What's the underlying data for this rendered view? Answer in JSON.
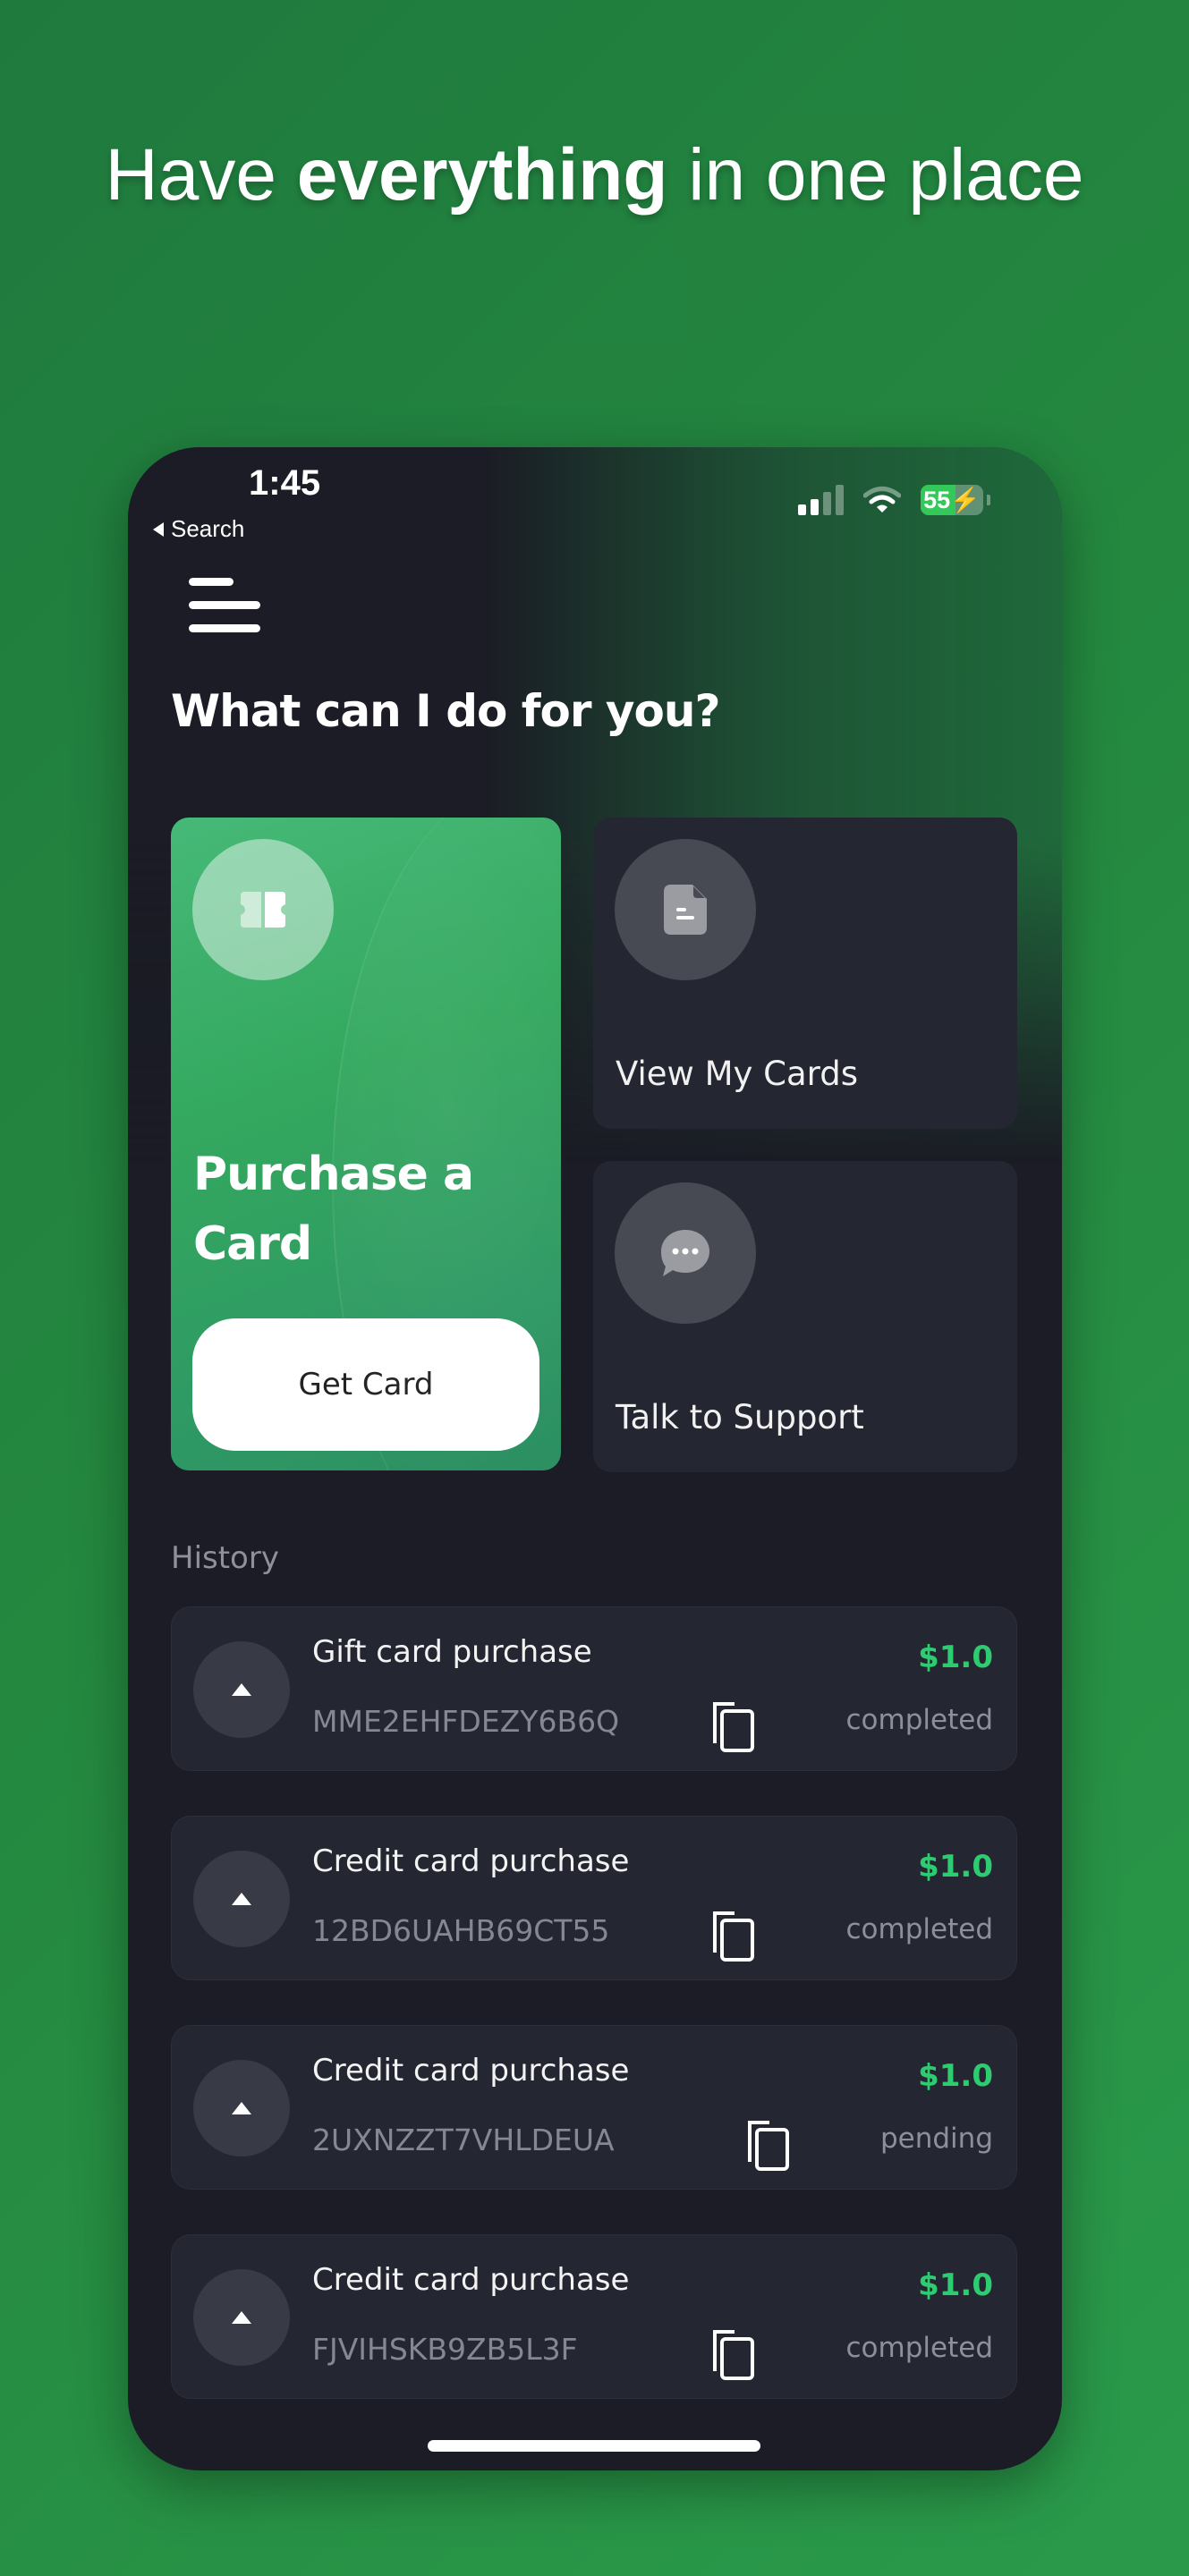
{
  "headline": {
    "prefix": "Have ",
    "bold": "everything",
    "suffix": " in one place"
  },
  "status_bar": {
    "time": "1:45",
    "back_label": "Search",
    "battery_percent": 55,
    "battery_text": "55",
    "battery_charging": true,
    "signal_bars_active": 2,
    "signal_bars_total": 4,
    "icons": [
      "signal-icon",
      "wifi-icon",
      "battery-charging-icon"
    ]
  },
  "header": {
    "menu_icon": "hamburger-menu-icon",
    "title": "What can I do for you?"
  },
  "actions": {
    "purchase": {
      "icon": "ticket-card-icon",
      "title": "Purchase a Card",
      "button_label": "Get Card"
    },
    "view_cards": {
      "icon": "document-icon",
      "label": "View My Cards"
    },
    "support": {
      "icon": "chat-bubble-icon",
      "label": "Talk to Support"
    }
  },
  "history": {
    "label": "History",
    "items": [
      {
        "title": "Gift card purchase",
        "ref": "MME2EHFDEZY6B6Q",
        "amount": "$1.0",
        "status": "completed",
        "direction_icon": "arrow-up-icon",
        "copy_icon": "copy-icon"
      },
      {
        "title": "Credit card purchase",
        "ref": "12BD6UAHB69CT55",
        "amount": "$1.0",
        "status": "completed",
        "direction_icon": "arrow-up-icon",
        "copy_icon": "copy-icon"
      },
      {
        "title": "Credit card purchase",
        "ref": "2UXNZZT7VHLDEUA",
        "amount": "$1.0",
        "status": "pending",
        "direction_icon": "arrow-up-icon",
        "copy_icon": "copy-icon"
      },
      {
        "title": "Credit card purchase",
        "ref": "FJVIHSKB9ZB5L3F",
        "amount": "$1.0",
        "status": "completed",
        "direction_icon": "arrow-up-icon",
        "copy_icon": "copy-icon"
      }
    ]
  },
  "colors": {
    "accent_green": "#2ecc71",
    "background_green": "#24883f",
    "app_background": "#1b1c25",
    "card_background": "#242631"
  }
}
